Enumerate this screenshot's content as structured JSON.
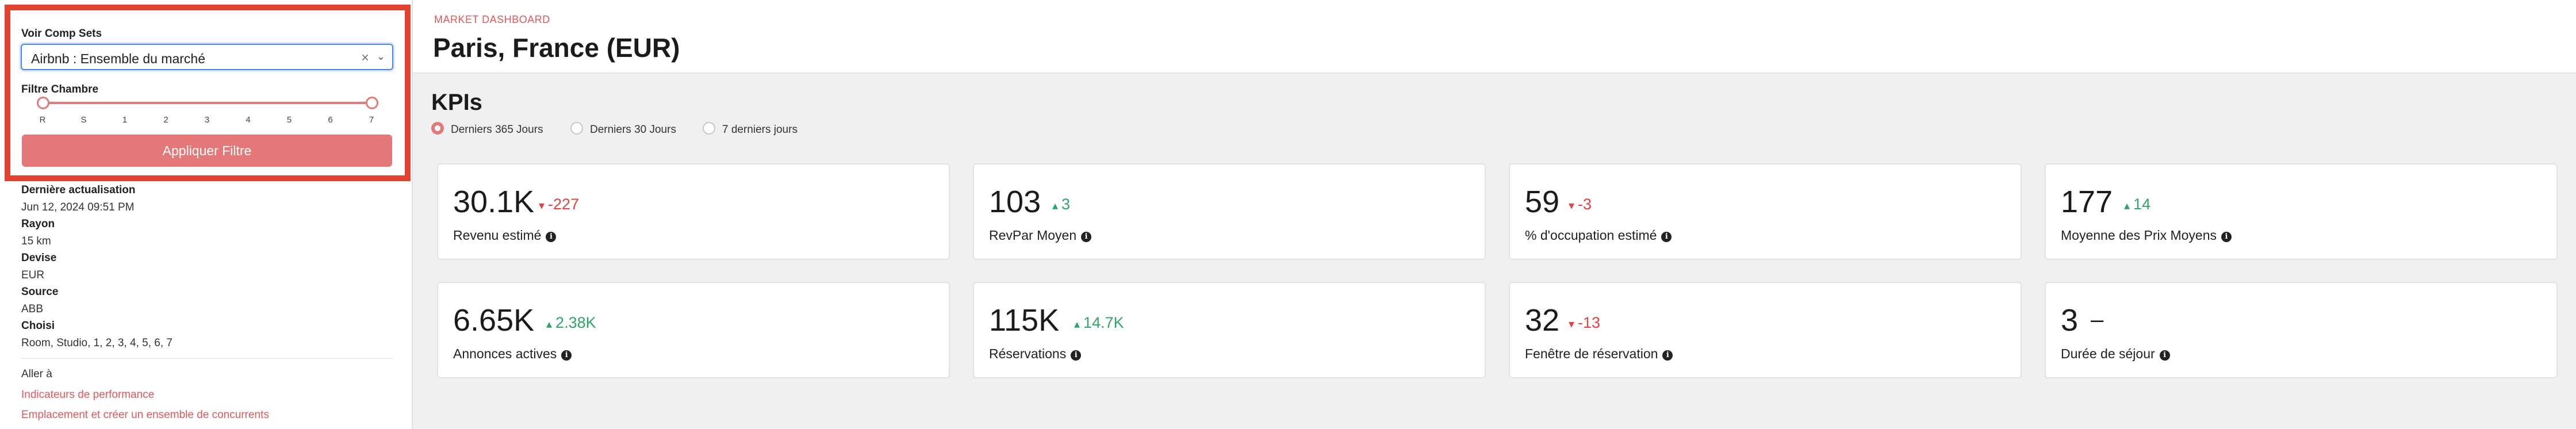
{
  "sidebar": {
    "comp_sets_label": "Voir Comp Sets",
    "comp_sets_value": "Airbnb : Ensemble du marché",
    "room_filter_label": "Filtre Chambre",
    "slider_ticks": [
      "R",
      "S",
      "1",
      "2",
      "3",
      "4",
      "5",
      "6",
      "7"
    ],
    "apply_label": "Appliquer Filtre",
    "meta": [
      {
        "label": "Dernière actualisation",
        "value": "Jun 12, 2024 09:51 PM"
      },
      {
        "label": "Rayon",
        "value": "15 km"
      },
      {
        "label": "Devise",
        "value": "EUR"
      },
      {
        "label": "Source",
        "value": "ABB"
      },
      {
        "label": "Choisi",
        "value": "Room, Studio, 1, 2, 3, 4, 5, 6, 7"
      }
    ],
    "goto_label": "Aller à",
    "links": [
      "Indicateurs de performance",
      "Emplacement et créer un ensemble de concurrents"
    ]
  },
  "header": {
    "breadcrumb": "MARKET DASHBOARD",
    "title": "Paris, France (EUR)"
  },
  "kpis": {
    "title": "KPIs",
    "periods": [
      "Derniers 365 Jours",
      "Derniers 30 Jours",
      "7 derniers jours"
    ],
    "selected_period": "Derniers 365 Jours",
    "cards": [
      {
        "value": "30.1K",
        "delta": "-227",
        "direction": "down",
        "label": "Revenu estimé"
      },
      {
        "value": "103",
        "delta": "3",
        "direction": "up",
        "label": "RevPar Moyen"
      },
      {
        "value": "59",
        "delta": "-3",
        "direction": "down",
        "label": "% d'occupation estimé"
      },
      {
        "value": "177",
        "delta": "14",
        "direction": "up",
        "label": "Moyenne des Prix Moyens"
      },
      {
        "value": "6.65K",
        "delta": "2.38K",
        "direction": "up",
        "label": "Annonces actives"
      },
      {
        "value": "115K",
        "delta": "14.7K",
        "direction": "up",
        "label": "Réservations"
      },
      {
        "value": "32",
        "delta": "-13",
        "direction": "down",
        "label": "Fenêtre de réservation"
      },
      {
        "value": "3",
        "delta": "–",
        "direction": "neutral",
        "label": "Durée de séjour"
      }
    ]
  },
  "colors": {
    "accent": "#e07b7b",
    "highlight_border": "#e0432f",
    "up": "#2fa56a",
    "down": "#e0453f",
    "link": "#e0595c"
  }
}
